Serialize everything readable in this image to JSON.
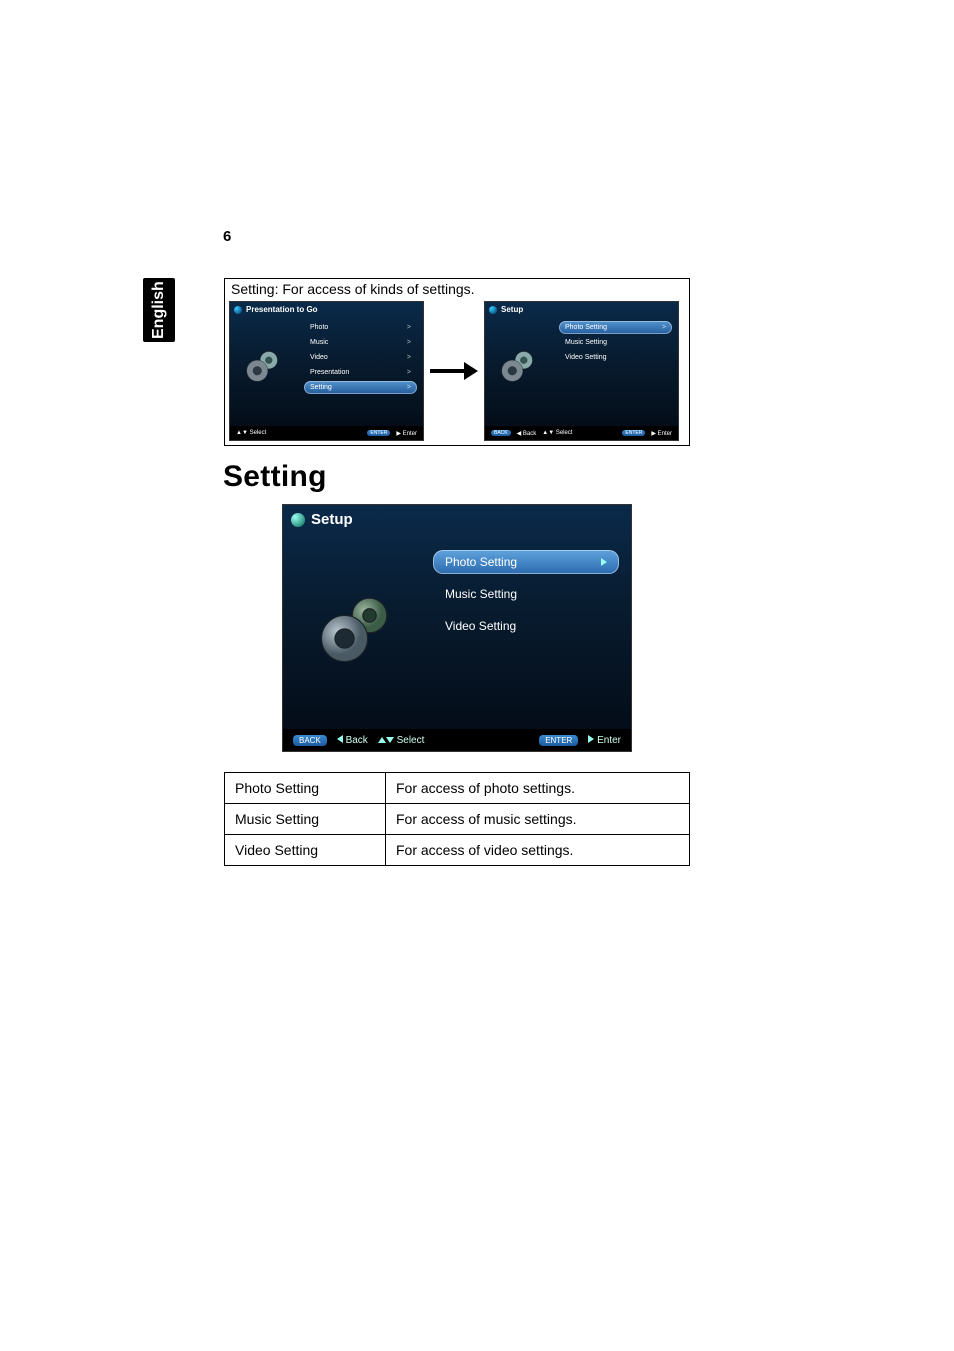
{
  "page_number": "6",
  "language_tab": "English",
  "box_caption": "Setting: For access of kinds of settings.",
  "mini_screen_left": {
    "title": "Presentation to Go",
    "items": [
      {
        "label": "Photo",
        "arrow": ">"
      },
      {
        "label": "Music",
        "arrow": ">"
      },
      {
        "label": "Video",
        "arrow": ">"
      },
      {
        "label": "Presentation",
        "arrow": ">"
      },
      {
        "label": "Setting",
        "arrow": ">",
        "selected": true
      }
    ],
    "footer": {
      "select_symbol": "▲▼",
      "select_label": "Select",
      "enter_pill": "ENTER",
      "enter_symbol": "▶",
      "enter_label": "Enter"
    }
  },
  "mini_screen_right": {
    "title": "Setup",
    "items": [
      {
        "label": "Photo Setting",
        "arrow": ">",
        "selected": true
      },
      {
        "label": "Music Setting"
      },
      {
        "label": "Video Setting"
      }
    ],
    "footer": {
      "back_pill": "BACK",
      "back_symbol": "◀",
      "back_label": "Back",
      "select_symbol": "▲▼",
      "select_label": "Select",
      "enter_pill": "ENTER",
      "enter_symbol": "▶",
      "enter_label": "Enter"
    }
  },
  "heading": "Setting",
  "big_screen": {
    "title": "Setup",
    "items": [
      {
        "label": "Photo Setting",
        "selected": true
      },
      {
        "label": "Music Setting"
      },
      {
        "label": "Video Setting"
      }
    ],
    "footer": {
      "back_pill": "BACK",
      "back_label": "Back",
      "select_label": "Select",
      "enter_pill": "ENTER",
      "enter_label": "Enter"
    }
  },
  "table": {
    "rows": [
      {
        "name": "Photo Setting",
        "desc": "For access of photo settings."
      },
      {
        "name": "Music Setting",
        "desc": "For access of music settings."
      },
      {
        "name": "Video Setting",
        "desc": "For access of video settings."
      }
    ]
  }
}
